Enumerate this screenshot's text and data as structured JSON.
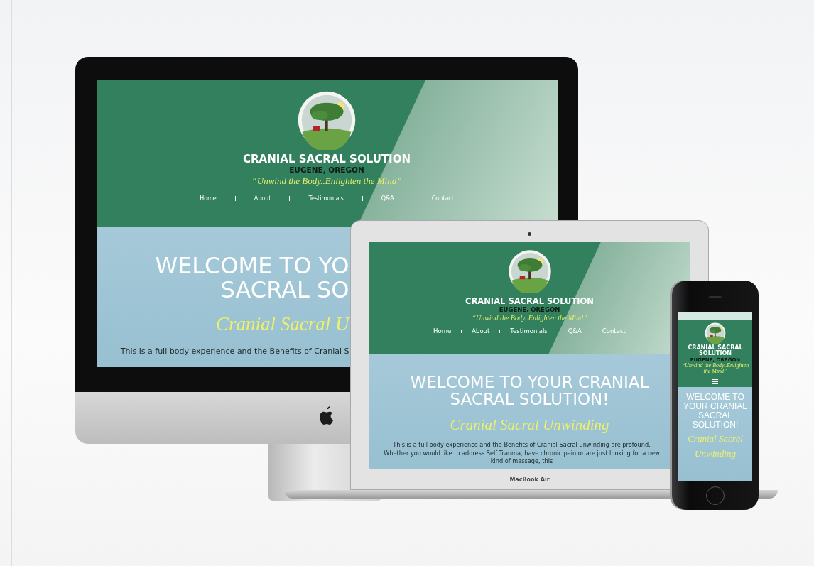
{
  "desktop": {
    "site": {
      "brand": "CRANIAL SACRAL SOLUTION",
      "location": "EUGENE, OREGON",
      "tagline": "“Unwind the Body..Enlighten the Mind”",
      "nav": [
        "Home",
        "About",
        "Testimonials",
        "Q&A",
        "Contact"
      ],
      "heading_lines": [
        "WELCOME TO YO",
        "SACRAL SO"
      ],
      "subheading_lines": [
        "Cranial Sacral U"
      ],
      "intro": "This is a full body experience and the Benefits of Cranial S"
    }
  },
  "laptop": {
    "site": {
      "brand": "CRANIAL SACRAL SOLUTION",
      "location": "EUGENE, OREGON",
      "tagline": "“Unwind the Body..Enlighten the Mind”",
      "nav": [
        "Home",
        "About",
        "Testimonials",
        "Q&A",
        "Contact"
      ],
      "heading_lines": [
        "WELCOME TO YOUR CRANIAL",
        "SACRAL SOLUTION!"
      ],
      "subheading_lines": [
        "Cranial Sacral Unwinding"
      ],
      "intro": "This is a full body experience and the Benefits of Cranial Sacral unwinding are profound. Whether you would like to address Self Trauma, have chronic pain or are just looking for a new kind of massage, this"
    },
    "model": "MacBook Air"
  },
  "phone": {
    "site": {
      "brand": "CRANIAL SACRAL SOLUTION",
      "location": "EUGENE, OREGON",
      "tagline": "“Unwind the Body..Enlighten the Mind”",
      "menu": true,
      "heading_lines": [
        "WELCOME TO",
        "YOUR CRANIAL",
        "SACRAL",
        "SOLUTION!"
      ],
      "subheading_lines": [
        "Cranial Sacral",
        "Unwinding"
      ]
    }
  }
}
